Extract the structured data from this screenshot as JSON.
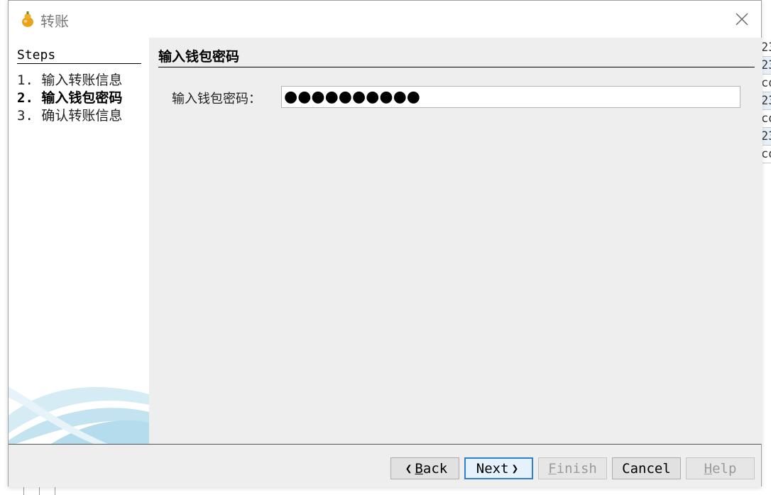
{
  "dialog": {
    "title": "转账",
    "app_icon": "wallet-gourd-icon",
    "close_icon": "close-icon"
  },
  "steps": {
    "heading": "Steps",
    "items": [
      {
        "label": "1. 输入转账信息",
        "current": false
      },
      {
        "label": "2. 输入钱包密码",
        "current": true
      },
      {
        "label": "3. 确认转账信息",
        "current": false
      }
    ]
  },
  "panel": {
    "title": "输入钱包密码",
    "password_label": "输入钱包密码：",
    "password_value": "●●●●●●●●●●"
  },
  "buttons": {
    "back_mnemonic": "B",
    "back_rest": "ack",
    "next_mnemonic": "N",
    "next_rest": "ext",
    "finish_mnemonic": "F",
    "finish_rest": "inish",
    "cancel": "Cancel",
    "help_mnemonic": "H",
    "help_rest": "elp"
  },
  "background": {
    "cells": [
      "23",
      "23",
      "co",
      "23",
      "co",
      "23",
      "co"
    ]
  },
  "colors": {
    "accent": "#2f7fd0",
    "content_bg": "#eeeeee"
  }
}
